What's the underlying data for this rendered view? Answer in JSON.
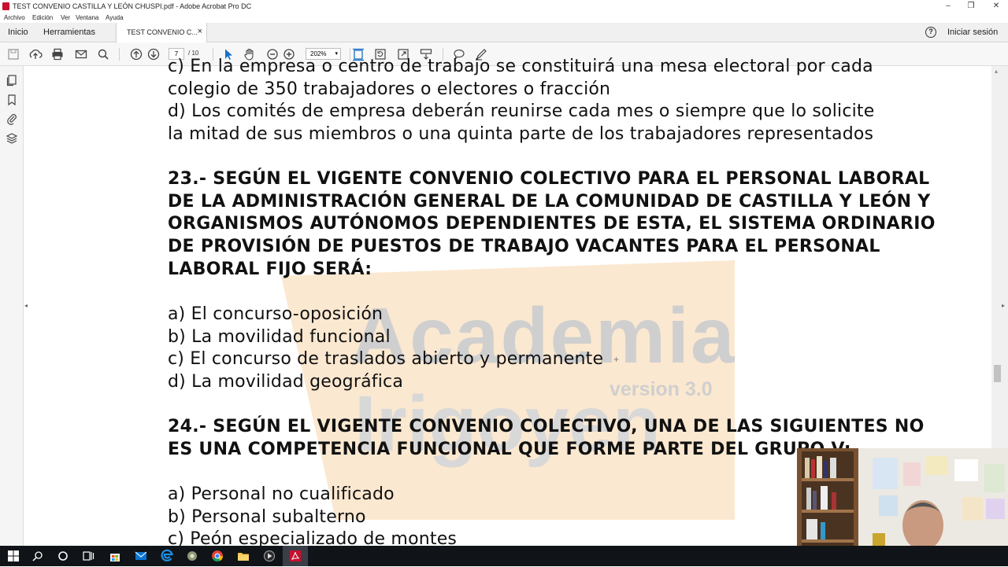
{
  "window": {
    "title": "TEST CONVENIO CASTILLA Y LEÓN  CHUSPI.pdf - Adobe Acrobat Pro DC",
    "minimize": "–",
    "restore": "❐",
    "close": "✕"
  },
  "menu": [
    "Archivo",
    "Edición",
    "Ver",
    "Ventana",
    "Ayuda"
  ],
  "tabs": {
    "home": "Inicio",
    "tools": "Herramientas",
    "document": "TEST CONVENIO C...",
    "close": "×",
    "help": "?",
    "signin": "Iniciar sesión"
  },
  "toolbar": {
    "page_current": "7",
    "page_total": "/ 10",
    "zoom": "202%",
    "zoom_arrow": "▾",
    "icons": [
      "save-icon",
      "upload-icon",
      "print-icon",
      "email-icon",
      "search-icon",
      "prev-page-icon",
      "next-page-icon",
      "select-arrow-icon",
      "hand-icon",
      "zoom-out-icon",
      "zoom-in-icon",
      "fit-page-icon",
      "rotate-icon",
      "fullscreen-icon",
      "scroll-mode-icon",
      "comment-icon",
      "pen-icon"
    ]
  },
  "leftpane": {
    "icons": [
      "pages-icon",
      "bookmark-icon",
      "attachment-icon",
      "layers-icon"
    ],
    "collapse": "◂"
  },
  "scroll": {
    "up": "▴",
    "collapse": "▸"
  },
  "watermark": {
    "line1": "Academia",
    "line2": "version 3.0",
    "line3": "Irigoyen"
  },
  "document": {
    "lines": [
      "c) En la empresa o centro de trabajo se constituirá una mesa electoral por cada",
      "colegio de 350 trabajadores o electores o fracción",
      "d) Los comités de empresa deberán reunirse cada mes o siempre que lo solicite",
      "la mitad de sus miembros o una quinta parte de los trabajadores representados"
    ],
    "q23": [
      "23.- SEGÚN EL VIGENTE CONVENIO COLECTIVO PARA EL PERSONAL LABORAL",
      "DE LA ADMINISTRACIÓN GENERAL DE LA COMUNIDAD DE CASTILLA Y LEÓN Y",
      "ORGANISMOS AUTÓNOMOS DEPENDIENTES DE ESTA, EL SISTEMA ORDINARIO",
      "DE PROVISIÓN DE PUESTOS DE TRABAJO VACANTES PARA EL PERSONAL",
      "LABORAL FIJO SERÁ:"
    ],
    "q23_answers": [
      "a) El concurso-oposición",
      "b) La movilidad funcional",
      "c) El concurso de traslados abierto y permanente",
      "d) La movilidad geográfica"
    ],
    "q24": [
      "24.- SEGÚN EL VIGENTE CONVENIO COLECTIVO, UNA DE LAS SIGUIENTES NO",
      "ES UNA COMPETENCIA FUNCIONAL QUE FORME PARTE DEL GRUPO V:"
    ],
    "q24_answers": [
      "a) Personal no cualificado",
      "b) Personal subalterno",
      "c) Peón especializado de montes"
    ],
    "cursor": "+"
  },
  "taskbar": {
    "icons": [
      "windows-start-icon",
      "search-icon",
      "cortana-icon",
      "task-view-icon",
      "store-icon",
      "mail-icon",
      "edge-icon",
      "app-icon",
      "chrome-icon",
      "explorer-icon",
      "media-icon",
      "acrobat-icon"
    ]
  },
  "colors": {
    "acrobat_red": "#c8102e",
    "watermark_orange": "#fbe8d0",
    "taskbar": "#101418",
    "tool_blue": "#1a6fc4"
  }
}
